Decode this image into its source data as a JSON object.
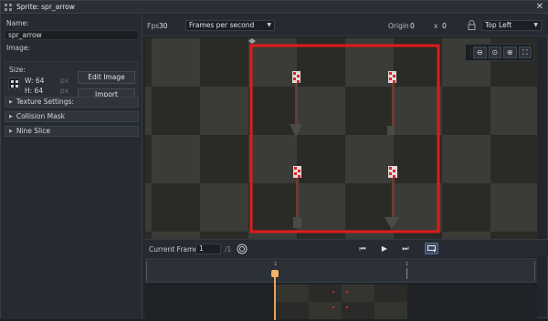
{
  "window": {
    "title": "Sprite: spr_arrow"
  },
  "left_panel": {
    "name_label": "Name:",
    "name_value": "spr_arrow",
    "image_label": "Image:",
    "size_label": "Size:",
    "width_text": "W: 64",
    "height_text": "H: 64",
    "unit": "px",
    "edit_image": "Edit Image",
    "import": "Import",
    "sections": [
      "Texture Settings:",
      "Collision Mask",
      "Nine Slice"
    ]
  },
  "toolbar": {
    "fps_label": "Fps",
    "fps_value": "30",
    "fps_mode": "Frames per second",
    "origin_label": "Origin",
    "origin_x": "0",
    "x_label": "x",
    "origin_y": "0",
    "origin_preset": "Top Left"
  },
  "playback": {
    "current_frame_label": "Current Frame:",
    "current_frame": "1",
    "total_frames": "/1"
  },
  "timeline": {
    "ticks": [
      "1",
      "1"
    ]
  },
  "colors": {
    "accent": "#e8a25a",
    "selection": "#e01b1b",
    "loop_active": "#3b4a63"
  }
}
